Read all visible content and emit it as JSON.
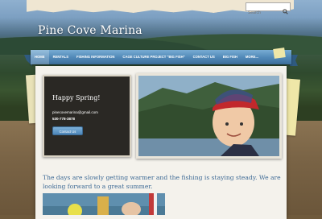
{
  "search": {
    "placeholder": "Search"
  },
  "site": {
    "title": "Pine Cove Marina"
  },
  "nav": {
    "items": [
      {
        "label": "HOME",
        "active": true
      },
      {
        "label": "RENTALS"
      },
      {
        "label": "FISHING INFORMATION"
      },
      {
        "label": "CAGE CULTURE PROJECT \"BIG FISH\""
      },
      {
        "label": "CONTACT US"
      },
      {
        "label": "BIG FISH"
      },
      {
        "label": "MORE..."
      }
    ]
  },
  "intro": {
    "heading": "Happy Spring!",
    "email": "pinecovemarina@gmail.com",
    "phone": "530-778-3878",
    "button": "Contact Us"
  },
  "content": {
    "lead": "The days are slowly getting warmer and the fishing is staying steady. We are looking forward to a great summer."
  },
  "colors": {
    "nav": "#4f87b6",
    "lead_text": "#3f6b96",
    "intro_bg": "#2a2824"
  }
}
